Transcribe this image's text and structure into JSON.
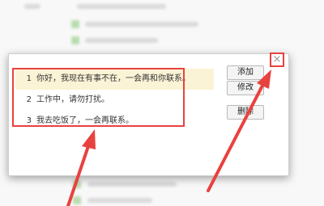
{
  "dialog": {
    "close_label": "×",
    "items": [
      {
        "num": "1",
        "text": "你好，我现在有事不在，一会再和你联系。"
      },
      {
        "num": "2",
        "text": "工作中，请勿打扰。"
      },
      {
        "num": "3",
        "text": "我去吃饭了，一会再联系。"
      }
    ],
    "buttons": {
      "add": "添加",
      "modify": "修改",
      "delete": "删除"
    }
  },
  "colors": {
    "highlight": "#e8423f",
    "selected_row": "#fbf3d6"
  },
  "icons": [
    "close-icon",
    "arrow-annotation-icon"
  ]
}
